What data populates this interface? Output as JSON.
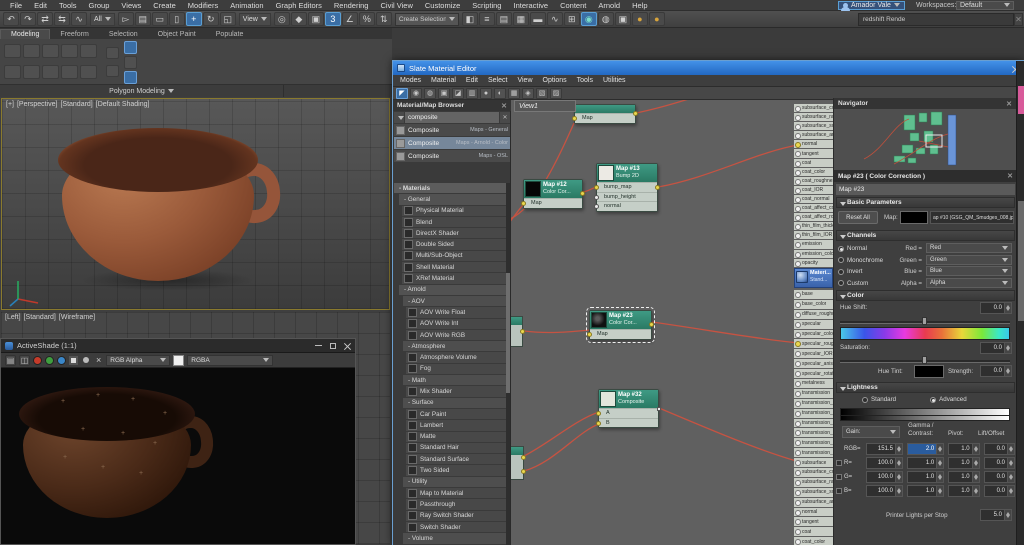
{
  "app": {
    "menu": [
      "File",
      "Edit",
      "Tools",
      "Group",
      "Views",
      "Create",
      "Modifiers",
      "Animation",
      "Graph Editors",
      "Rendering",
      "Civil View",
      "Customize",
      "Scripting",
      "Interactive",
      "Content",
      "Arnold",
      "Help"
    ],
    "user_name": "Amador Vale",
    "workspaces_label": "Workspaces:",
    "workspace_value": "Default",
    "render_search_value": "redshift Rende",
    "selection_filter_value": "All",
    "coord_system_value": "View",
    "named_selection_value": "Create Selection Se",
    "icons_a": [
      {
        "name": "undo-icon",
        "glyph": "↶",
        "cls": ""
      },
      {
        "name": "redo-icon",
        "glyph": "↷",
        "cls": ""
      },
      {
        "name": "select-and-link-icon",
        "glyph": "⇄",
        "cls": ""
      },
      {
        "name": "unlink-selection-icon",
        "glyph": "⇆",
        "cls": ""
      },
      {
        "name": "bind-to-space-warp-icon",
        "glyph": "∿",
        "cls": ""
      }
    ],
    "icons_b": [
      {
        "name": "select-object-icon",
        "glyph": "▻",
        "cls": ""
      },
      {
        "name": "select-by-name-icon",
        "glyph": "▤",
        "cls": ""
      },
      {
        "name": "rectangular-selection-icon",
        "glyph": "▭",
        "cls": ""
      },
      {
        "name": "window-crossing-icon",
        "glyph": "▯",
        "cls": ""
      },
      {
        "name": "select-and-move-icon",
        "glyph": "+",
        "cls": "active"
      },
      {
        "name": "select-and-rotate-icon",
        "glyph": "↻",
        "cls": ""
      },
      {
        "name": "select-and-scale-icon",
        "glyph": "◱",
        "cls": ""
      }
    ],
    "icons_c": [
      {
        "name": "use-pivot-center-icon",
        "glyph": "◎",
        "cls": ""
      },
      {
        "name": "select-and-manipulate-icon",
        "glyph": "◆",
        "cls": ""
      },
      {
        "name": "keyboard-override-icon",
        "glyph": "▣",
        "cls": ""
      },
      {
        "name": "snaps-toggle-icon",
        "glyph": "3",
        "cls": "active"
      },
      {
        "name": "angle-snap-icon",
        "glyph": "∠",
        "cls": ""
      },
      {
        "name": "percent-snap-icon",
        "glyph": "%",
        "cls": ""
      },
      {
        "name": "spinner-snap-icon",
        "glyph": "⇅",
        "cls": ""
      }
    ],
    "icons_d": [
      {
        "name": "mirror-icon",
        "glyph": "◧",
        "cls": ""
      },
      {
        "name": "align-icon",
        "glyph": "≡",
        "cls": ""
      },
      {
        "name": "scene-explorer-icon",
        "glyph": "▤",
        "cls": ""
      },
      {
        "name": "layer-explorer-icon",
        "glyph": "▦",
        "cls": ""
      },
      {
        "name": "ribbon-toggle-icon",
        "glyph": "▬",
        "cls": ""
      },
      {
        "name": "curve-editor-icon",
        "glyph": "∿",
        "cls": ""
      },
      {
        "name": "schematic-view-icon",
        "glyph": "⊞",
        "cls": ""
      },
      {
        "name": "material-editor-icon",
        "glyph": "◉",
        "cls": "mat"
      },
      {
        "name": "render-setup-icon",
        "glyph": "◍",
        "cls": ""
      },
      {
        "name": "rendered-frame-icon",
        "glyph": "▣",
        "cls": ""
      },
      {
        "name": "render-production-icon",
        "glyph": "●",
        "cls": "gold"
      },
      {
        "name": "render-iterative-icon",
        "glyph": "●",
        "cls": "gold"
      }
    ]
  },
  "ribbon": {
    "tabs": [
      {
        "label": "Modeling",
        "cls": "active"
      },
      {
        "label": "Freeform",
        "cls": ""
      },
      {
        "label": "Selection",
        "cls": ""
      },
      {
        "label": "Object Paint",
        "cls": ""
      },
      {
        "label": "Populate",
        "cls": ""
      }
    ],
    "polygon_modeling": "Polygon Modeling"
  },
  "viewport": {
    "labels1": [
      "[+]",
      "[Perspective]",
      "[Standard]",
      "[Default Shading]"
    ],
    "labels2": [
      "[Left]",
      "[Standard]",
      "[Wireframe]"
    ]
  },
  "activeshade": {
    "title": "ActiveShade (1:1)",
    "channel_dropdown": "RGB Alpha",
    "format_dropdown": "RGBA"
  },
  "sme": {
    "title": "Slate Material Editor",
    "menus": [
      "Modes",
      "Material",
      "Edit",
      "Select",
      "View",
      "Options",
      "Tools",
      "Utilities"
    ],
    "toolbar_icons": [
      {
        "name": "select-tool-icon",
        "glyph": "◤",
        "cls": "active"
      },
      {
        "name": "pick-material-icon",
        "glyph": "◉",
        "cls": ""
      },
      {
        "name": "assign-to-selection-icon",
        "glyph": "◍",
        "cls": ""
      },
      {
        "name": "delete-selected-icon",
        "glyph": "▣",
        "cls": ""
      },
      {
        "name": "move-children-icon",
        "glyph": "◪",
        "cls": ""
      },
      {
        "name": "hide-unused-slots-icon",
        "glyph": "▥",
        "cls": ""
      },
      {
        "name": "show-background-icon",
        "glyph": "●",
        "cls": ""
      },
      {
        "name": "show-end-result-icon",
        "glyph": "◐",
        "cls": ""
      },
      {
        "name": "layout-all-icon",
        "glyph": "▦",
        "cls": ""
      },
      {
        "name": "material-id-icon",
        "glyph": "◈",
        "cls": ""
      },
      {
        "name": "select-by-material-icon",
        "glyph": "▧",
        "cls": ""
      },
      {
        "name": "zoom-extents-icon",
        "glyph": "▨",
        "cls": ""
      }
    ],
    "browser": {
      "title": "Material/Map Browser",
      "search_value": "composite",
      "results": [
        {
          "name": "Composite",
          "cat": "Maps - General",
          "cls": ""
        },
        {
          "name": "Composite",
          "cat": "Maps - Arnold - Color",
          "cls": "sel"
        },
        {
          "name": "Composite",
          "cat": "Maps - OSL",
          "cls": ""
        }
      ],
      "tree": [
        {
          "label": "- Materials",
          "cls": "sec1"
        },
        {
          "label": "- General",
          "cls": "sec2"
        },
        {
          "label": "Physical Material",
          "cls": "itm"
        },
        {
          "label": "Blend",
          "cls": "itm"
        },
        {
          "label": "DirectX Shader",
          "cls": "itm"
        },
        {
          "label": "Double Sided",
          "cls": "itm"
        },
        {
          "label": "Multi/Sub-Object",
          "cls": "itm"
        },
        {
          "label": "Shell Material",
          "cls": "itm"
        },
        {
          "label": "XRef Material",
          "cls": "itm"
        },
        {
          "label": "- Arnold",
          "cls": "sec2"
        },
        {
          "label": "- AOV",
          "cls": "sec3"
        },
        {
          "label": "AOV Write Float",
          "cls": "itm2"
        },
        {
          "label": "AOV Write Int",
          "cls": "itm2"
        },
        {
          "label": "AOV Write RGB",
          "cls": "itm2"
        },
        {
          "label": "- Atmosphere",
          "cls": "sec3"
        },
        {
          "label": "Atmosphere Volume",
          "cls": "itm2"
        },
        {
          "label": "Fog",
          "cls": "itm2"
        },
        {
          "label": "- Math",
          "cls": "sec3"
        },
        {
          "label": "Mix Shader",
          "cls": "itm2"
        },
        {
          "label": "- Surface",
          "cls": "sec3"
        },
        {
          "label": "Car Paint",
          "cls": "itm2"
        },
        {
          "label": "Lambert",
          "cls": "itm2"
        },
        {
          "label": "Matte",
          "cls": "itm2"
        },
        {
          "label": "Standard Hair",
          "cls": "itm2"
        },
        {
          "label": "Standard Surface",
          "cls": "itm2"
        },
        {
          "label": "Two Sided",
          "cls": "itm2"
        },
        {
          "label": "- Utility",
          "cls": "sec3"
        },
        {
          "label": "Map to Material",
          "cls": "itm2"
        },
        {
          "label": "Passthrough",
          "cls": "itm2"
        },
        {
          "label": "Ray Switch Shader",
          "cls": "itm2"
        },
        {
          "label": "Switch Shader",
          "cls": "itm2"
        },
        {
          "label": "- Volume",
          "cls": "sec3"
        }
      ]
    },
    "view_tab": "View1",
    "nodes": {
      "maptop": {
        "slot": "Map"
      },
      "map12": {
        "name": "Map #12",
        "type": "Color Cor...",
        "slot": "Map"
      },
      "map13": {
        "name": "Map #13",
        "type": "Bump 2D",
        "slots": [
          "bump_map",
          "bump_height",
          "normal"
        ]
      },
      "map23": {
        "name": "Map #23",
        "type": "Color Cor...",
        "slot": "Map"
      },
      "map32": {
        "name": "Map #32",
        "type": "Composite",
        "slots": [
          "A",
          "B"
        ]
      },
      "surface_partial": {
        "name": "Materi...",
        "type": "Stand..."
      },
      "upper_slots": [
        {
          "label": "subsurface_color",
          "cls": ""
        },
        {
          "label": "subsurface_radius",
          "cls": ""
        },
        {
          "label": "subsurface_scale",
          "cls": ""
        },
        {
          "label": "subsurface_aniso",
          "cls": ""
        },
        {
          "label": "normal",
          "cls": "on"
        },
        {
          "label": "tangent",
          "cls": ""
        },
        {
          "label": "coat",
          "cls": ""
        },
        {
          "label": "coat_color",
          "cls": ""
        },
        {
          "label": "coat_roughness",
          "cls": ""
        },
        {
          "label": "coat_IOR",
          "cls": ""
        },
        {
          "label": "coat_normal",
          "cls": ""
        },
        {
          "label": "coat_affect_color",
          "cls": ""
        },
        {
          "label": "coat_affect_rough",
          "cls": ""
        },
        {
          "label": "thin_film_thickness",
          "cls": ""
        },
        {
          "label": "thin_film_IOR",
          "cls": ""
        },
        {
          "label": "emission",
          "cls": ""
        },
        {
          "label": "emission_color",
          "cls": ""
        },
        {
          "label": "opacity",
          "cls": ""
        }
      ],
      "lower_slots": [
        {
          "label": "base",
          "cls": ""
        },
        {
          "label": "base_color",
          "cls": ""
        },
        {
          "label": "diffuse_roughness",
          "cls": ""
        },
        {
          "label": "specular",
          "cls": ""
        },
        {
          "label": "specular_color",
          "cls": ""
        },
        {
          "label": "specular_roughness",
          "cls": "on"
        },
        {
          "label": "specular_IOR",
          "cls": ""
        },
        {
          "label": "specular_anisotropy",
          "cls": ""
        },
        {
          "label": "specular_rotation",
          "cls": ""
        },
        {
          "label": "metalness",
          "cls": ""
        },
        {
          "label": "transmission",
          "cls": ""
        },
        {
          "label": "transmission_color",
          "cls": ""
        },
        {
          "label": "transmission_depth",
          "cls": ""
        },
        {
          "label": "transmission_scatter",
          "cls": ""
        },
        {
          "label": "transmission_scatter_a",
          "cls": ""
        },
        {
          "label": "transmission_dispersion",
          "cls": ""
        },
        {
          "label": "transmission_extra_rou",
          "cls": ""
        },
        {
          "label": "subsurface",
          "cls": ""
        },
        {
          "label": "subsurface_color",
          "cls": ""
        },
        {
          "label": "subsurface_radius",
          "cls": ""
        },
        {
          "label": "subsurface_scale",
          "cls": ""
        },
        {
          "label": "subsurface_aniso",
          "cls": ""
        },
        {
          "label": "normal",
          "cls": ""
        },
        {
          "label": "tangent",
          "cls": ""
        },
        {
          "label": "coat",
          "cls": ""
        },
        {
          "label": "coat_color",
          "cls": ""
        }
      ]
    },
    "navigator": {
      "title": "Navigator"
    },
    "params": {
      "header": "Map #23  ( Color Correction )",
      "name_value": "Map #23",
      "basic": {
        "title": "Basic Parameters",
        "reset_label": "Reset All",
        "map_label": "Map:",
        "map_value": "ap #10 (GSG_QM_Smudges_008.jp"
      },
      "channels": {
        "title": "Channels",
        "radios": [
          {
            "label": "Normal",
            "state": "on"
          },
          {
            "label": "Monochrome",
            "state": ""
          },
          {
            "label": "Invert",
            "state": ""
          },
          {
            "label": "Custom",
            "state": ""
          }
        ],
        "rows": [
          {
            "eq": "Red =",
            "value": "Red"
          },
          {
            "eq": "Green =",
            "value": "Green"
          },
          {
            "eq": "Blue =",
            "value": "Blue"
          },
          {
            "eq": "Alpha =",
            "value": "Alpha"
          }
        ]
      },
      "color": {
        "title": "Color",
        "hue_shift_label": "Hue Shift:",
        "hue_shift_value": "0.0",
        "saturation_label": "Saturation:",
        "saturation_value": "0.0",
        "hue_tint_label": "Hue Tint:",
        "strength_label": "Strength:",
        "strength_value": "0.0"
      },
      "lightness": {
        "title": "Lightness",
        "modes": [
          {
            "label": "Standard",
            "state": ""
          },
          {
            "label": "Advanced",
            "state": "on"
          }
        ],
        "gain_label": "Gain:",
        "col_gamma_1": "Gamma /",
        "col_gamma_2": "Contrast:",
        "col_pivot": "Pivot:",
        "col_lift": "Lift/Offset",
        "rows": [
          {
            "label": "RGB=",
            "gain": "151.5",
            "gamma": "2.0",
            "pivot": "1.0",
            "lift": "0.0",
            "gcls": "hl",
            "chk": ""
          },
          {
            "label": "R=",
            "gain": "100.0",
            "gamma": "1.0",
            "pivot": "1.0",
            "lift": "0.0",
            "gcls": "",
            "chk": "box"
          },
          {
            "label": "G=",
            "gain": "100.0",
            "gamma": "1.0",
            "pivot": "1.0",
            "lift": "0.0",
            "gcls": "",
            "chk": "box"
          },
          {
            "label": "B=",
            "gain": "100.0",
            "gamma": "1.0",
            "pivot": "1.0",
            "lift": "0.0",
            "gcls": "",
            "chk": "box"
          }
        ],
        "printer_label": "Printer Lights per Stop",
        "printer_value": "5.0"
      }
    }
  }
}
